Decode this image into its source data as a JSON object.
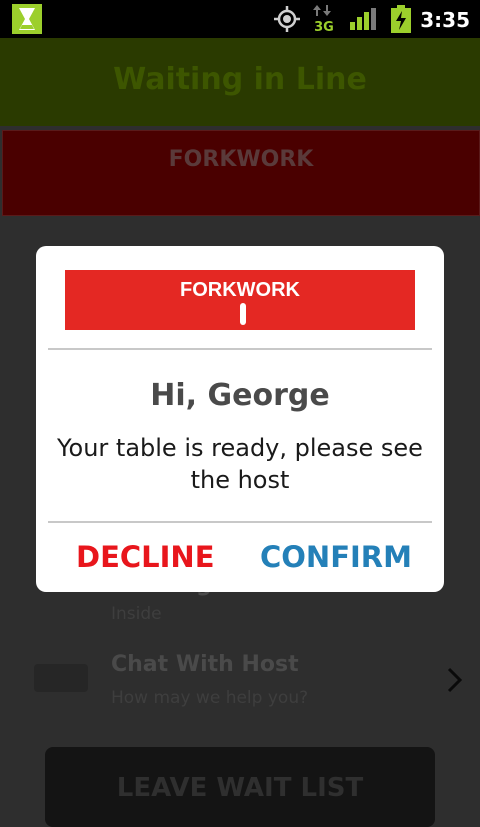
{
  "status_bar": {
    "time": "3:35",
    "network_label": "3G"
  },
  "background": {
    "header_title": "Waiting in Line",
    "brand_logo": "FORKWORK",
    "row_partial_label": "g",
    "row_partial_sub": "Inside",
    "chat_title": "Chat With Host",
    "chat_subtitle": "How may we help you?",
    "leave_button": "LEAVE WAIT LIST"
  },
  "dialog": {
    "logo_text": "FORKWORK",
    "greeting": "Hi, George",
    "message": "Your table is ready, please see the host",
    "decline_label": "DECLINE",
    "confirm_label": "CONFIRM"
  },
  "colors": {
    "brand_red": "#e42823",
    "decline": "#e8161c",
    "confirm": "#2480b8",
    "status_green": "#9ccf2c"
  }
}
